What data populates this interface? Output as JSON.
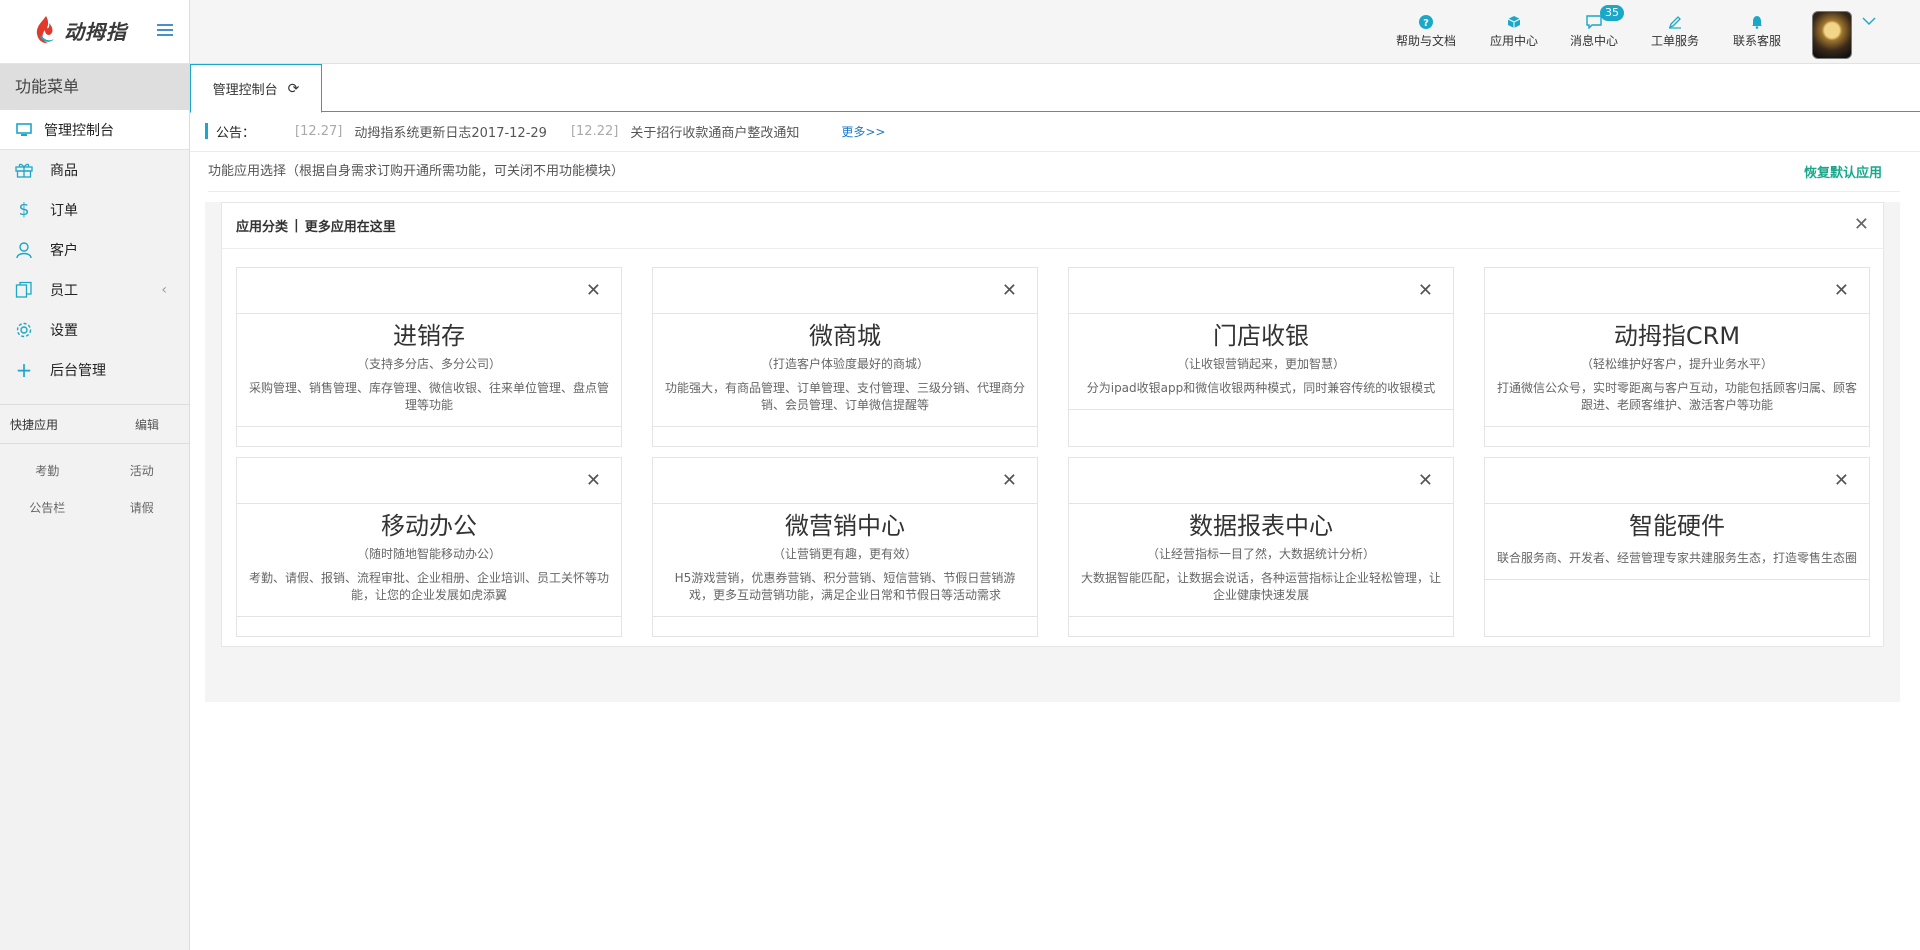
{
  "brand": {
    "name": "动拇指"
  },
  "sidebar": {
    "title": "功能菜单",
    "items": [
      {
        "label": "管理控制台",
        "icon": "monitor-icon"
      },
      {
        "label": "商品",
        "icon": "gift-icon"
      },
      {
        "label": "订单",
        "icon": "dollar-icon"
      },
      {
        "label": "客户",
        "icon": "user-icon"
      },
      {
        "label": "员工",
        "icon": "copy-icon",
        "arrow": "‹"
      },
      {
        "label": "设置",
        "icon": "gear-icon"
      },
      {
        "label": "后台管理",
        "icon": "plus-icon"
      }
    ],
    "quick": {
      "title": "快捷应用",
      "edit": "编辑",
      "items": [
        "考勤",
        "活动",
        "公告栏",
        "请假"
      ]
    }
  },
  "header": {
    "items": [
      {
        "label": "帮助与文档",
        "icon": "help-icon"
      },
      {
        "label": "应用中心",
        "icon": "cube-icon"
      },
      {
        "label": "消息中心",
        "icon": "message-icon",
        "badge": "35"
      },
      {
        "label": "工单服务",
        "icon": "pencil-icon"
      },
      {
        "label": "联系客服",
        "icon": "bell-icon"
      }
    ]
  },
  "tab": {
    "label": "管理控制台"
  },
  "notice": {
    "label": "公告：",
    "items": [
      {
        "date": "[12.27]",
        "text": "动拇指系统更新日志2017-12-29"
      },
      {
        "date": "[12.22]",
        "text": "关于招行收款通商户整改通知"
      }
    ],
    "more": "更多>>"
  },
  "func": {
    "title": "功能应用选择",
    "hint": "（根据自身需求订购开通所需功能，可关闭不用功能模块）",
    "restore": "恢复默认应用"
  },
  "panel": {
    "title": "应用分类",
    "sep": "|",
    "subtitle": "更多应用在这里",
    "cards": [
      {
        "title": "进销存",
        "sub": "（支持多分店、多分公司）",
        "desc": "采购管理、销售管理、库存管理、微信收银、往来单位管理、盘点管理等功能"
      },
      {
        "title": "微商城",
        "sub": "（打造客户体验度最好的商城）",
        "desc": "功能强大，有商品管理、订单管理、支付管理、三级分销、代理商分销、会员管理、订单微信提醒等"
      },
      {
        "title": "门店收银",
        "sub": "（让收银营销起来，更加智慧）",
        "desc": "分为ipad收银app和微信收银两种模式，同时兼容传统的收银模式"
      },
      {
        "title": "动拇指CRM",
        "sub": "（轻松维护好客户，提升业务水平）",
        "desc": "打通微信公众号，实时零距离与客户互动，功能包括顾客归属、顾客跟进、老顾客维护、激活客户等功能"
      },
      {
        "title": "移动办公",
        "sub": "（随时随地智能移动办公）",
        "desc": "考勤、请假、报销、流程审批、企业相册、企业培训、员工关怀等功能，让您的企业发展如虎添翼"
      },
      {
        "title": "微营销中心",
        "sub": "（让营销更有趣，更有效）",
        "desc": "H5游戏营销，优惠券营销、积分营销、短信营销、节假日营销游戏，更多互动营销功能，满足企业日常和节假日等活动需求"
      },
      {
        "title": "数据报表中心",
        "sub": "（让经营指标一目了然，大数据统计分析）",
        "desc": "大数据智能匹配，让数据会说话，各种运营指标让企业轻松管理，让企业健康快速发展"
      },
      {
        "title": "智能硬件",
        "sub": "",
        "desc": "联合服务商、开发者、经营管理专家共建服务生态，打造零售生态圈"
      }
    ]
  },
  "colors": {
    "accent": "#1aa7c8",
    "restore": "#19a98a",
    "link": "#1a7ac8"
  }
}
